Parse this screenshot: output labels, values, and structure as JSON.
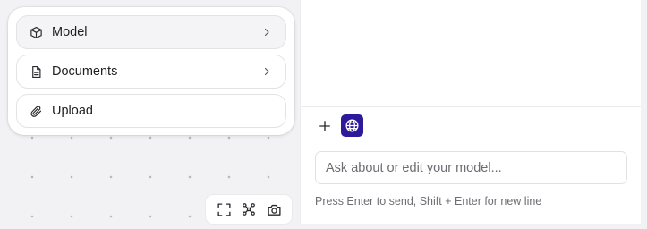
{
  "menu": {
    "items": [
      {
        "label": "Model",
        "icon": "cube-icon",
        "has_chevron": true,
        "active": true
      },
      {
        "label": "Documents",
        "icon": "document-icon",
        "has_chevron": true,
        "active": false
      },
      {
        "label": "Upload",
        "icon": "paperclip-icon",
        "has_chevron": false,
        "active": false
      }
    ]
  },
  "canvas_toolbar": {
    "buttons": [
      "fit-view-icon",
      "graph-icon",
      "camera-icon"
    ]
  },
  "chat": {
    "input_placeholder": "Ask about or edit your model...",
    "hint": "Press Enter to send, Shift + Enter for new line",
    "globe_color": "#2d1a9b"
  }
}
